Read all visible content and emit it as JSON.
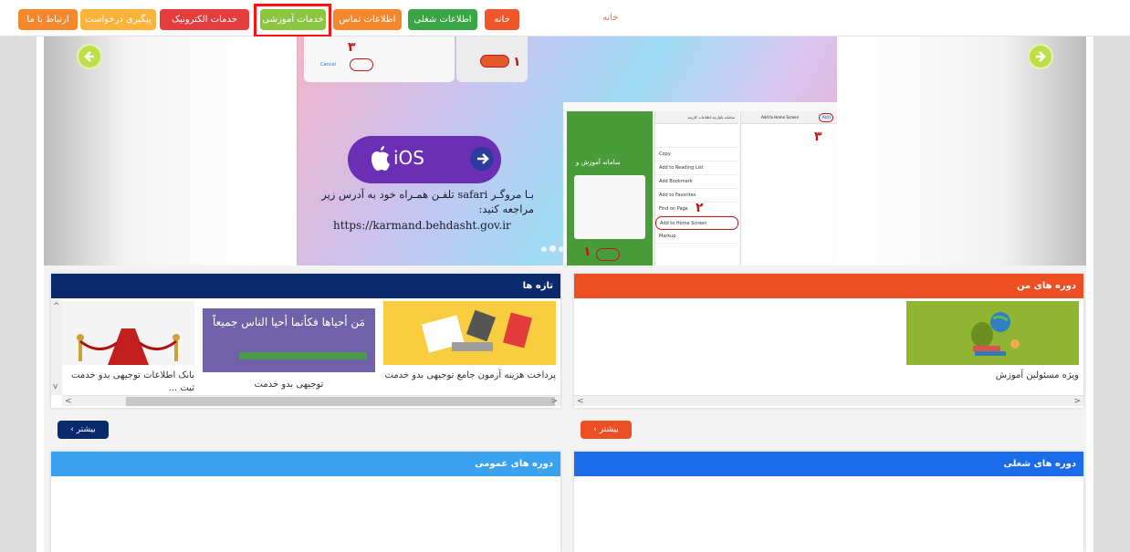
{
  "nav": {
    "items": [
      {
        "label": "ارتباط با ما",
        "color": "#f5882c"
      },
      {
        "label": "پیگیری درخواست",
        "color": "#fcb33b"
      },
      {
        "label": "خدمات الکترونیک",
        "color": "#e53d3d"
      },
      {
        "label": "خدمات آموزشی",
        "color": "#8cc641",
        "highlight": "#ff0000"
      },
      {
        "label": "اطلاعات تماس",
        "color": "#f5882c"
      },
      {
        "label": "اطلاعات شغلی",
        "color": "#3aa544"
      },
      {
        "label": "خانه",
        "color": "#f0562c"
      }
    ],
    "breadcrumb": "خانه"
  },
  "slider": {
    "ios_label": "iOS",
    "instruction": "بـا مروگـر safari تلفـن همـراه خود به آدرس زیر مراجعه کنید:",
    "url": "https://karmand.behdasht.gov.ir",
    "step_numbers": [
      "۱",
      "۲",
      "۳"
    ],
    "menu_items": [
      "Copy",
      "Add to Reading List",
      "Add Bookmark",
      "Add to Favorites",
      "Find on Page",
      "Add to Home Screen",
      "Markup"
    ],
    "app_title": "سامانه آموزش و",
    "add_screen_title": "Add to Home Screen",
    "add_label": "Add",
    "cancel_label": "Cancel",
    "site_title": "سامانه یکپارچه اطلاعات کارمند"
  },
  "panels": {
    "my_courses": {
      "title": "دوره های من",
      "color": "#ec4f24",
      "cards": [
        {
          "title": "ویژه مسئولین آموزش"
        }
      ],
      "more": "بیشتر",
      "more_color": "#ec4f24"
    },
    "news": {
      "title": "تازه ها",
      "color": "#0b2a6e",
      "cards": [
        {
          "title": "پرداخت هزینه آزمون جامع توجیهی بدو خدمت"
        },
        {
          "title": "توجیهی بدو خدمت",
          "banner": "مَن أحياها فكأنما أحيا الناس جميعاً"
        },
        {
          "title": "بانک اطلاعات توجیهی بدو خدمت ثبت ..."
        }
      ],
      "more": "بیشتر",
      "more_color": "#0b2a6e"
    },
    "job_courses": {
      "title": "دوره های شغلی",
      "color": "#1c6cea"
    },
    "general_courses": {
      "title": "دوره های عمومی",
      "color": "#3aa2ee"
    }
  }
}
